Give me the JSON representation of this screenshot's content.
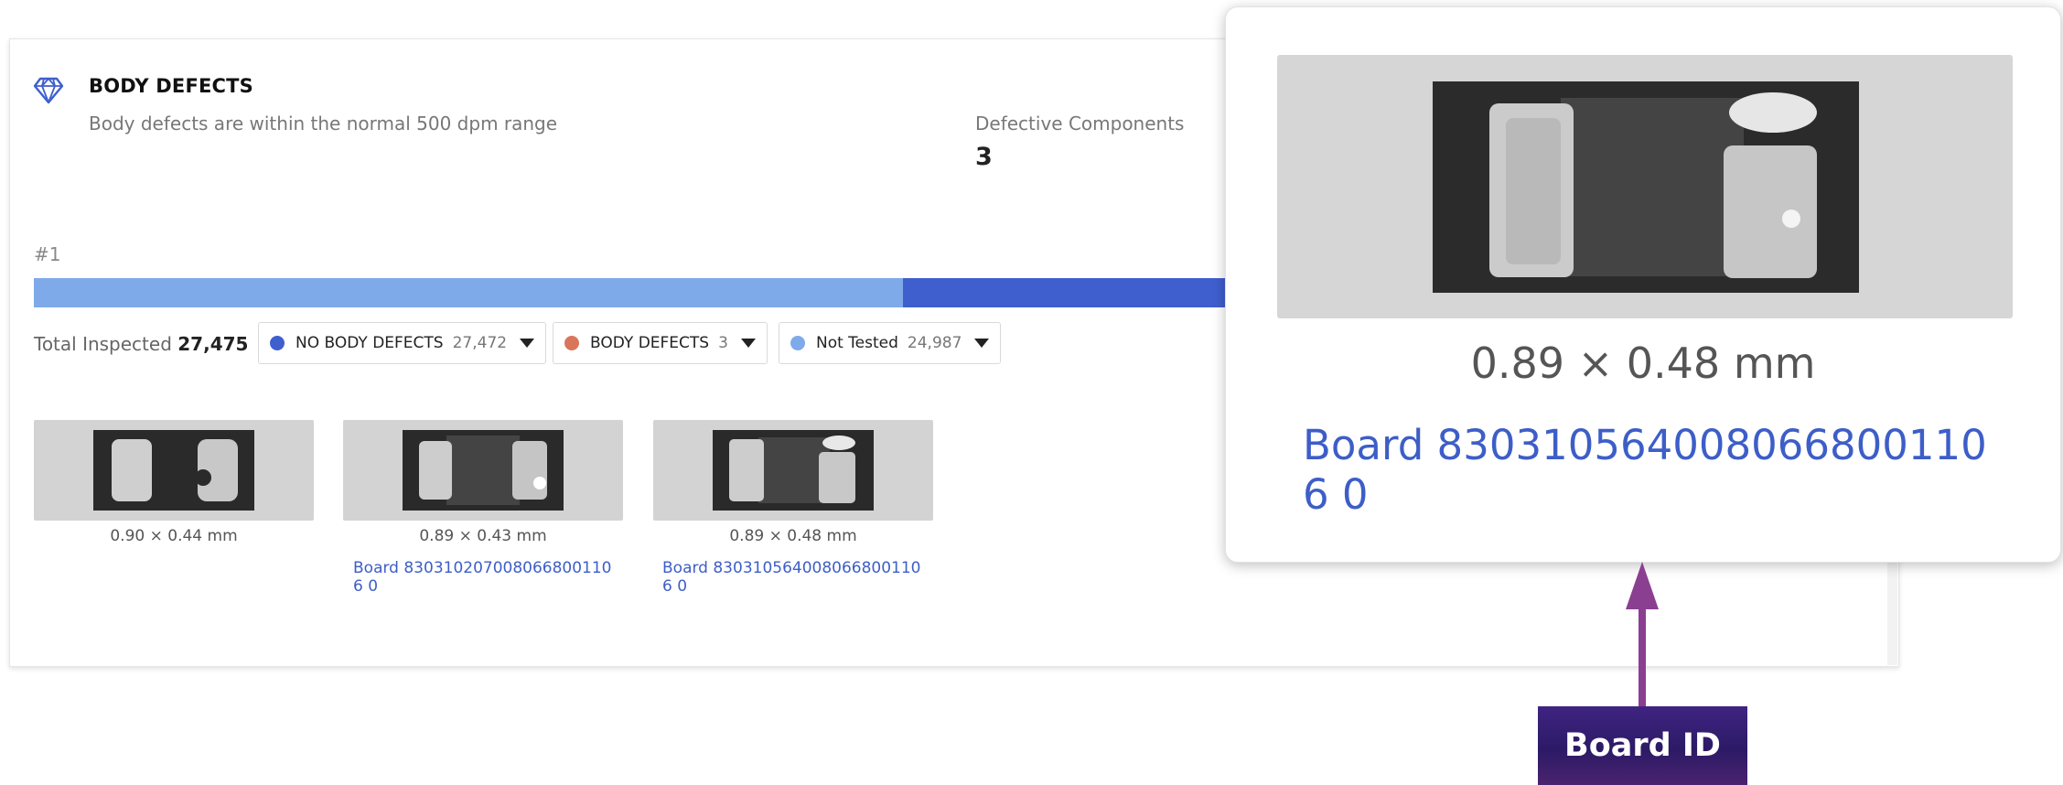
{
  "section": {
    "icon": "gem-icon",
    "title": "BODY DEFECTS",
    "subtitle": "Body defects are within the normal 500 dpm range",
    "defective_label": "Defective Components",
    "defective_value": "3",
    "rank_label": "#1"
  },
  "progress": {
    "light_fraction": 0.725,
    "dark_fraction": 0.275,
    "light_color": "#7faaea",
    "dark_color": "#3f5fce"
  },
  "summary": {
    "total_label": "Total Inspected",
    "total_value": "27,475"
  },
  "filters": [
    {
      "label": "NO BODY DEFECTS",
      "count": "27,472",
      "color": "#3f5fce"
    },
    {
      "label": "BODY DEFECTS",
      "count": "3",
      "color": "#d9765a"
    },
    {
      "label": "Not Tested",
      "count": "24,987",
      "color": "#7faaea"
    }
  ],
  "components": [
    {
      "dims": "0.90 × 0.44 mm",
      "board": ""
    },
    {
      "dims": "0.89 × 0.43 mm",
      "board": "Board 8303102070080668001106 0"
    },
    {
      "dims": "0.89 × 0.48 mm",
      "board": "Board 8303105640080668001106 0"
    }
  ],
  "popup": {
    "dims": "0.89 × 0.48 mm",
    "board": "Board 8303105640080668001106 0"
  },
  "callout": {
    "label": "Board ID",
    "arrow_color": "#8b3f91"
  }
}
